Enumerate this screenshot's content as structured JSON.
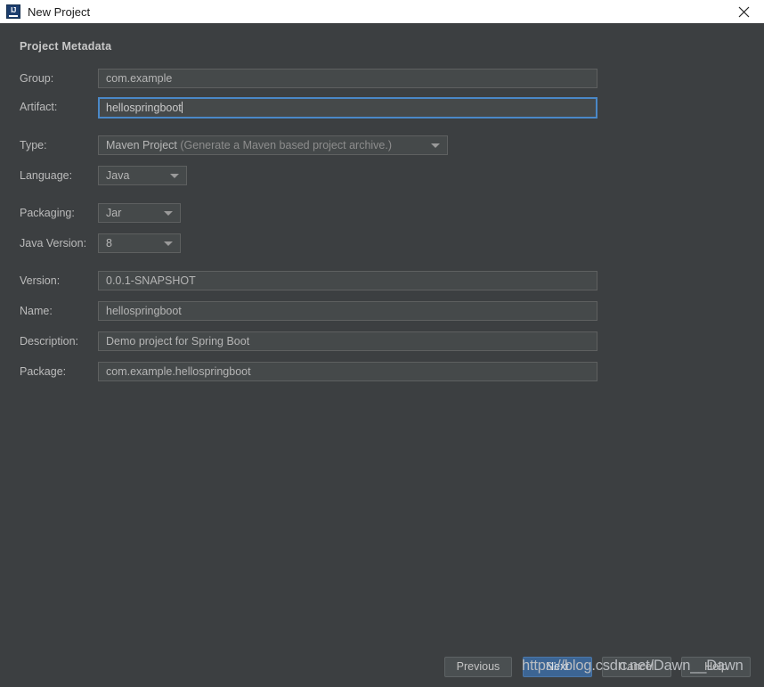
{
  "window": {
    "title": "New Project",
    "icon": "intellij-idea-logo",
    "close_icon": "close-icon",
    "ij_mark": "IJ"
  },
  "section": {
    "title": "Project Metadata"
  },
  "form": {
    "group": {
      "label": "Group:",
      "value": "com.example"
    },
    "artifact": {
      "label": "Artifact:",
      "value": "hellospringboot"
    },
    "type": {
      "label": "Type:",
      "value": "Maven Project",
      "hint": "(Generate a Maven based project archive.)"
    },
    "language": {
      "label": "Language:",
      "value": "Java"
    },
    "packaging": {
      "label": "Packaging:",
      "value": "Jar"
    },
    "java_version": {
      "label": "Java Version:",
      "value": "8"
    },
    "version": {
      "label": "Version:",
      "value": "0.0.1-SNAPSHOT"
    },
    "name": {
      "label": "Name:",
      "value": "hellospringboot"
    },
    "description": {
      "label": "Description:",
      "value": "Demo project for Spring Boot"
    },
    "package": {
      "label": "Package:",
      "value": "com.example.hellospringboot"
    }
  },
  "buttons": {
    "previous": "Previous",
    "next": "Next",
    "cancel": "Cancel",
    "help": "Help"
  },
  "watermark": {
    "text": "https://blog.csdn.net/Dawn__Dawn"
  },
  "colors": {
    "panel_bg": "#3c3f41",
    "field_bg": "#45494a",
    "focus_border": "#4a88c7",
    "primary_button": "#3c6594",
    "titlebar_bg": "#ffffff"
  }
}
